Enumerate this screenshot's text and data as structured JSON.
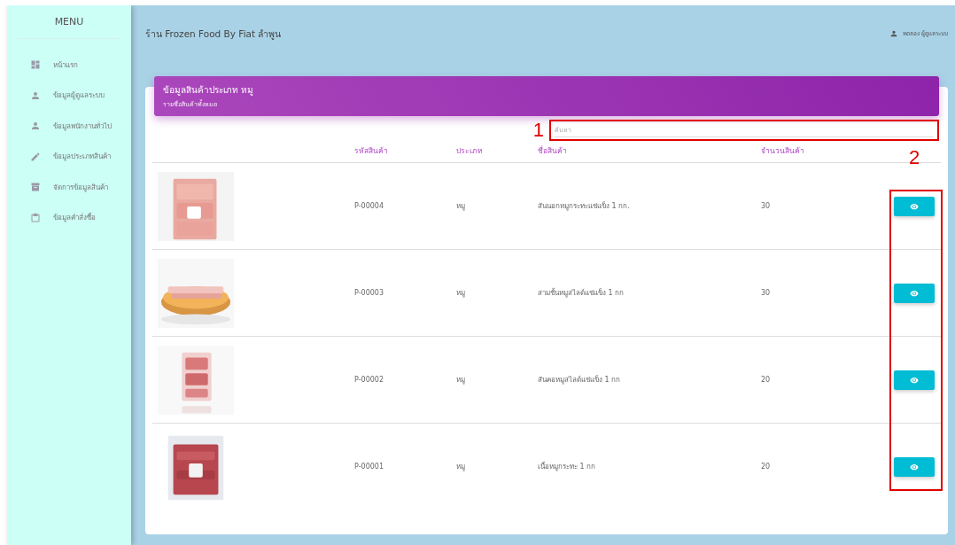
{
  "sidebar": {
    "title": "MENU",
    "items": [
      {
        "label": "หน้าแรก"
      },
      {
        "label": "ข้อมูลผู้ดูแลระบบ"
      },
      {
        "label": "ข้อมูลพนักงานทั่วไป"
      },
      {
        "label": "ข้อมูลประเภทสินค้า"
      },
      {
        "label": "จัดการข้อมูลสินค้า"
      },
      {
        "label": "ข้อมูลคำสั่งซื้อ"
      }
    ]
  },
  "header": {
    "title": "ร้าน Frozen Food By Fiat ลำพูน",
    "user": "ทดลอง ผู้ดูแลระบบ"
  },
  "card": {
    "title": "ข้อมูลสินค้าประเภท หมู",
    "subtitle": "รายชื่อสินค้าทั้งหมด"
  },
  "search": {
    "placeholder": "ค้นหา"
  },
  "table": {
    "columns": [
      "รหัสสินค้า",
      "ประเภท",
      "ชื่อสินค้า",
      "จำนวนสินค้า"
    ],
    "rows": [
      {
        "code": "P-00004",
        "type": "หมู",
        "name": "สันนอกหมูกระทะแช่แข็ง 1 กก.",
        "quantity": "30"
      },
      {
        "code": "P-00003",
        "type": "หมู",
        "name": "สามชั้นหมูสไลด์แช่แข็ง 1 กก",
        "quantity": "30"
      },
      {
        "code": "P-00002",
        "type": "หมู",
        "name": "สันคอหมูสไลด์แช่แข็ง 1 กก",
        "quantity": "20"
      },
      {
        "code": "P-00001",
        "type": "หมู",
        "name": "เนื้อหมูกระทะ 1 กก",
        "quantity": "20"
      }
    ]
  },
  "annotations": [
    "1",
    "2"
  ]
}
